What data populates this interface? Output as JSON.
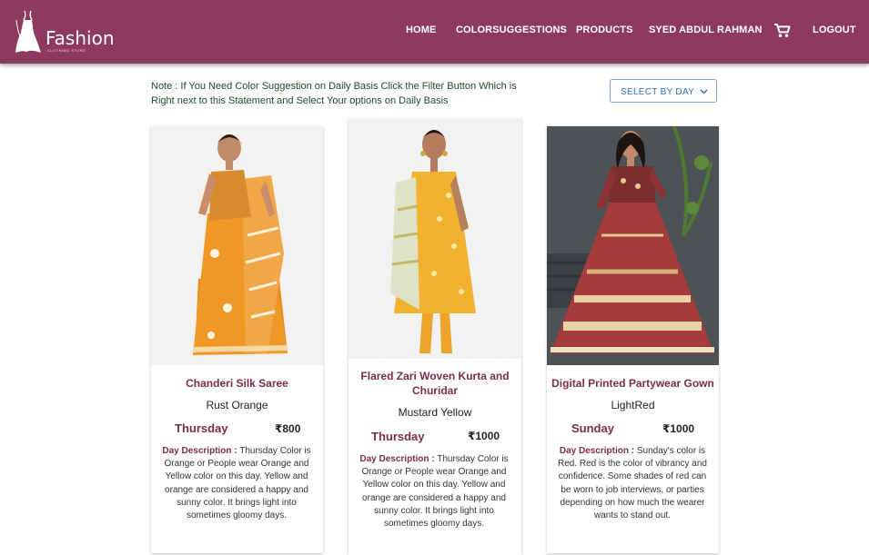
{
  "brand": {
    "name": "Fashion",
    "tagline": "CLOTHING STORE"
  },
  "nav": {
    "home": "HOME",
    "color_suggestions": "COLORSUGGESTIONS",
    "products": "PRODUCTS",
    "user": "SYED ABDUL RAHMAN",
    "cart_icon": "shopping-cart-icon",
    "logout": "LOGOUT"
  },
  "note": "Note : If You Need Color Suggestion on Daily Basis Click the Filter Button Which is Right next to this Statement and Select Your options on Daily Basis",
  "filter": {
    "label": "SELECT BY DAY",
    "icon": "chevron-down-icon"
  },
  "desc_label": "Day Description :",
  "colors": {
    "header": "#8e3a5e",
    "accent_text": "#7c2d4e",
    "note_text": "#1f4a2e",
    "filter_border": "#7aa6d6"
  },
  "products": [
    {
      "title": "Chanderi Silk Saree",
      "color": "Rust Orange",
      "day": "Thursday",
      "price": "₹800",
      "description": "Thursday Color is Orange or People wear Orange and Yellow color on this day. Yellow and orange are considered a happy and sunny color. It brings light into sometimes gloomy days."
    },
    {
      "title": "Flared Zari Woven Kurta and Churidar",
      "color": "Mustard Yellow",
      "day": "Thursday",
      "price": "₹1000",
      "description": "Thursday Color is Orange or People wear Orange and Yellow color on this day. Yellow and orange are considered a happy and sunny color. It brings light into sometimes gloomy days."
    },
    {
      "title": "Digital Printed Partywear Gown",
      "color": "LightRed",
      "day": "Sunday",
      "price": "₹1000",
      "description": "Sunday's color is Red. Red is the color of vibrancy and confidence. Some shades of red can be worn to job interviews, or parties depending on how much the wearer wants to stand out."
    }
  ]
}
